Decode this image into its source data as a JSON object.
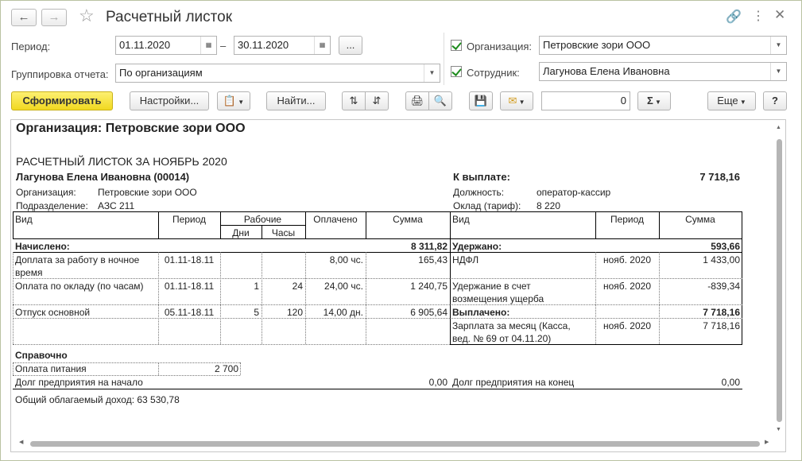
{
  "window": {
    "title": "Расчетный листок"
  },
  "form": {
    "period_label": "Период:",
    "period_from": "01.11.2020",
    "period_dash": "–",
    "period_to": "30.11.2020",
    "ellipsis": "...",
    "grouping_label": "Группировка отчета:",
    "grouping_value": "По организациям",
    "org_label": "Организация:",
    "org_value": "Петровские зори ООО",
    "emp_label": "Сотрудник:",
    "emp_value": "Лагунова Елена Ивановна"
  },
  "toolbar": {
    "generate": "Сформировать",
    "settings": "Настройки...",
    "find": "Найти...",
    "amount": "0",
    "sigma": "Σ",
    "more": "Еще",
    "help": "?"
  },
  "report": {
    "org_header": "Организация: Петровские зори ООО",
    "title": "РАСЧЕТНЫЙ ЛИСТОК ЗА НОЯБРЬ 2020",
    "employee": "Лагунова Елена Ивановна (00014)",
    "org_key": "Организация:",
    "org_val": "Петровские зори ООО",
    "dept_key": "Подразделение:",
    "dept_val": "АЗС 211",
    "topay_key": "К выплате:",
    "topay_val": "7 718,16",
    "position_key": "Должность:",
    "position_val": "оператор-кассир",
    "salary_key": "Оклад (тариф):",
    "salary_val": "8 220",
    "headers": {
      "vid": "Вид",
      "period": "Период",
      "working": "Рабочие",
      "days": "Дни",
      "hours": "Часы",
      "paid": "Оплачено",
      "sum": "Сумма",
      "vid2": "Вид",
      "period2": "Период",
      "sum2": "Сумма"
    },
    "accrued_label": "Начислено:",
    "accrued_total": "8 311,82",
    "withheld_label": "Удержано:",
    "withheld_total": "593,66",
    "left_rows": [
      {
        "vid1": "Доплата за работу в ночное",
        "vid2": "время",
        "period": "01.11-18.11",
        "days": "",
        "hours": "",
        "paid": "8,00 чс.",
        "sum": "165,43"
      },
      {
        "vid1": "Оплата по окладу (по часам)",
        "vid2": "",
        "period": "01.11-18.11",
        "days": "1",
        "hours": "24",
        "paid": "24,00 чс.",
        "sum": "1 240,75"
      },
      {
        "vid1": "Отпуск основной",
        "vid2": "",
        "period": "05.11-18.11",
        "days": "5",
        "hours": "120",
        "paid": "14,00 дн.",
        "sum": "6 905,64"
      }
    ],
    "right_rows": [
      {
        "vid1": "НДФЛ",
        "vid2": "",
        "period": "нояб. 2020",
        "sum": "1 433,00"
      },
      {
        "vid1": "Удержание в счет",
        "vid2": "возмещения ущерба",
        "period": "нояб. 2020",
        "sum": "-839,34"
      }
    ],
    "paid_label": "Выплачено:",
    "paid_total": "7 718,16",
    "paid_row": {
      "vid1": "Зарплата за месяц (Касса,",
      "vid2": "вед. № 69 от 04.11.20)",
      "period": "нояб. 2020",
      "sum": "7 718,16"
    },
    "ref_label": "Справочно",
    "meal_label": "Оплата питания",
    "meal_value": "2 700",
    "debt_start_label": "Долг предприятия на начало",
    "debt_start_value": "0,00",
    "debt_end_label": "Долг предприятия на конец",
    "debt_end_value": "0,00",
    "taxable_income": "Общий облагаемый доход: 63 530,78"
  },
  "colors": {
    "accent": "#f5dd2f",
    "check": "#1e8c1e"
  }
}
